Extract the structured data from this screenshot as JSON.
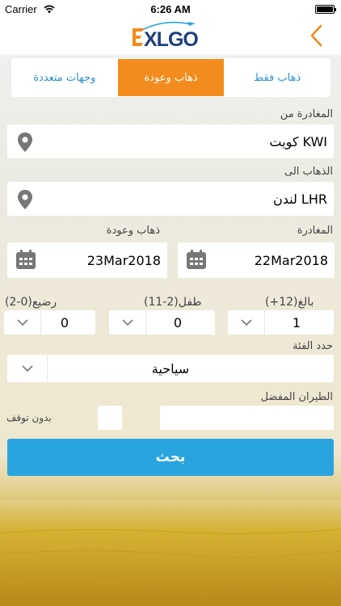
{
  "status_bar": {
    "carrier": "Carrier",
    "time": "6:26 AM"
  },
  "header": {
    "logo_text": "XLGO"
  },
  "trip_tabs": [
    {
      "label": "وجهات متعددة",
      "active": false
    },
    {
      "label": "ذهاب وعودة",
      "active": true
    },
    {
      "label": "ذهاب فقط",
      "active": false
    }
  ],
  "from": {
    "label": "المغادرة من",
    "value": "كويت KWI"
  },
  "to": {
    "label": "الذهاب الى",
    "value": "لندن LHR"
  },
  "return_date": {
    "label": "ذهاب وعودة",
    "value": "23Mar2018"
  },
  "departure_date": {
    "label": "المغادرة",
    "value": "22Mar2018"
  },
  "passengers": {
    "infant": {
      "label": "رضيع(0-2)",
      "value": "0"
    },
    "child": {
      "label": "طفل(2-11)",
      "value": "0"
    },
    "adult": {
      "label": "بالغ(12+)",
      "value": "1"
    }
  },
  "cabin_class": {
    "label": "حدد الفئة",
    "value": "سياحية"
  },
  "preferred_airline": {
    "label": "الطيران المفضل",
    "value": ""
  },
  "nonstop": {
    "label": "بدون توقف",
    "checked": false
  },
  "search_button": {
    "label": "بحث"
  },
  "colors": {
    "accent_orange": "#f28c1c",
    "accent_blue": "#2aa4df",
    "logo_navy": "#1d3f7a"
  }
}
